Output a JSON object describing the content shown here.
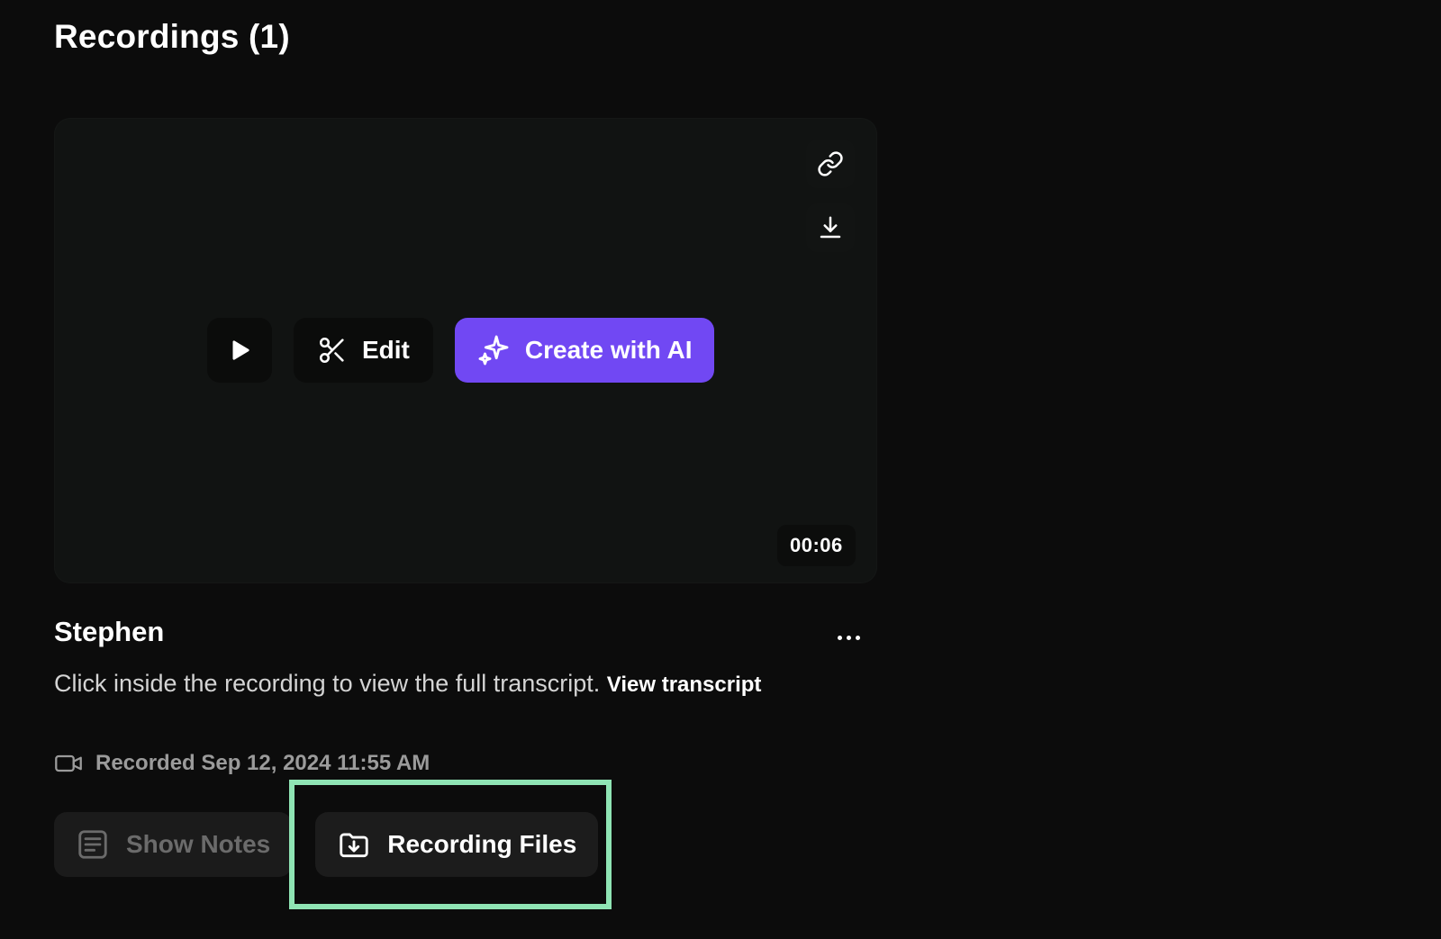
{
  "section": {
    "title": "Recordings (1)"
  },
  "player": {
    "edit_label": "Edit",
    "ai_label": "Create with AI",
    "duration": "00:06",
    "colors": {
      "ai_button": "#7148f3",
      "card_background": "#111312"
    },
    "icons": {
      "link": "link-icon",
      "download": "download-icon",
      "play": "play-icon",
      "edit": "scissors-icon",
      "ai": "sparkles-icon"
    }
  },
  "recording": {
    "title": "Stephen",
    "description": "Click inside the recording to view the full transcript.",
    "transcript_link": "View transcript",
    "recorded": "Recorded Sep 12, 2024 11:55 AM",
    "icons": {
      "more": "more-horizontal-icon",
      "camera": "video-camera-icon"
    }
  },
  "actions": {
    "show_notes_label": "Show Notes",
    "recording_files_label": "Recording Files",
    "icons": {
      "notes": "notes-icon",
      "files": "folder-download-icon"
    },
    "highlight_color": "#8fe4b4"
  }
}
